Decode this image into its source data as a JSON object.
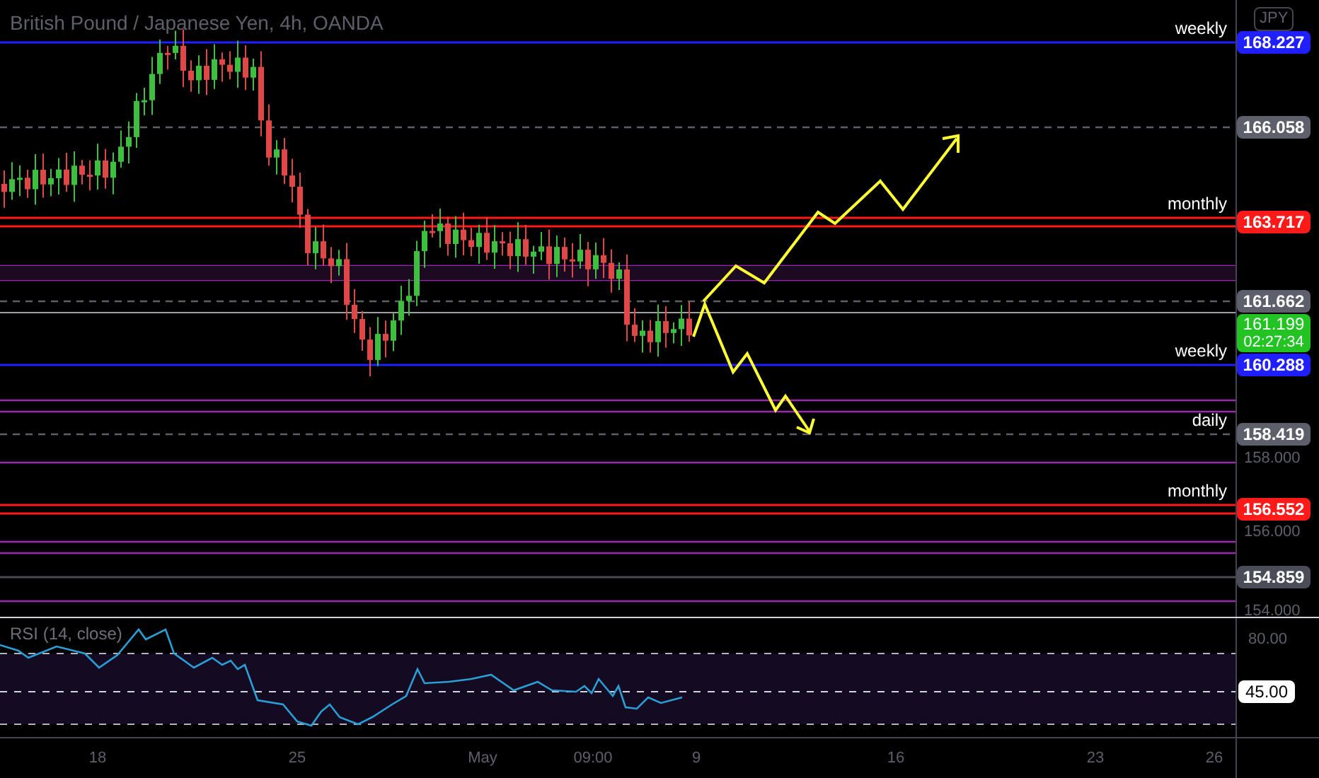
{
  "title": "British Pound / Japanese Yen, 4h, OANDA",
  "currency_badge": "JPY",
  "price_levels": [
    {
      "label": "weekly",
      "price": "168.227",
      "color": "#1f1fff",
      "kind": "solid"
    },
    {
      "price": "166.058",
      "color": "#5d606b",
      "kind": "dashed"
    },
    {
      "label": "monthly",
      "price": "163.717",
      "color": "#ff1a1a",
      "kind": "double"
    },
    {
      "price": "161.662",
      "color": "#5d606b",
      "kind": "dashed"
    },
    {
      "label": "weekly",
      "price": "160.288",
      "color": "#1f1fff",
      "kind": "solid"
    },
    {
      "label": "daily",
      "price": "158.419",
      "color": "#5d606b",
      "kind": "dashed"
    },
    {
      "label": "monthly",
      "price": "156.552",
      "color": "#ff1a1a",
      "kind": "double"
    },
    {
      "price": "154.859",
      "color": "#4a4d57",
      "kind": "solid"
    }
  ],
  "current_price": {
    "price": "161.199",
    "countdown": "02:27:34"
  },
  "price_ticks": [
    "158.000",
    "156.000",
    "154.000"
  ],
  "rsi": {
    "title": "RSI (14, close)",
    "tick": "80.00",
    "value": "45.00"
  },
  "time_ticks": [
    "18",
    "25",
    "May",
    "09:00",
    "9",
    "16",
    "23",
    "26"
  ]
}
